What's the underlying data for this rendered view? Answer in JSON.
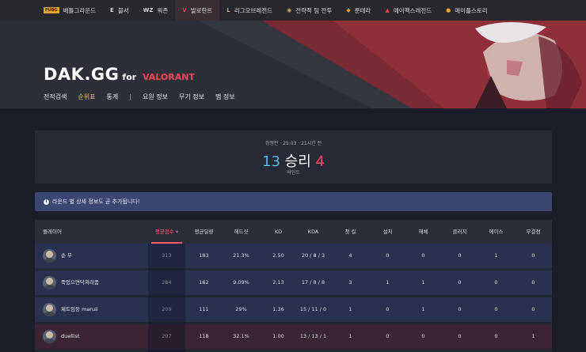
{
  "topbar": {
    "items": [
      {
        "icon": "pubg-icon",
        "glyph": "PUBG",
        "label": "배틀그라운드",
        "active": false
      },
      {
        "icon": "eternal-return-icon",
        "glyph": "E",
        "label": "블서",
        "active": false
      },
      {
        "icon": "warzone-icon",
        "glyph": "WZ",
        "label": "워존",
        "active": false
      },
      {
        "icon": "valorant-icon",
        "glyph": "V",
        "label": "발로란트",
        "active": true
      },
      {
        "icon": "lol-icon",
        "glyph": "L",
        "label": "리그오브레전드",
        "active": false
      },
      {
        "icon": "tft-icon",
        "glyph": "◉",
        "label": "전략적 팀 전투",
        "active": false
      },
      {
        "icon": "runeterra-icon",
        "glyph": "◆",
        "label": "룬테라",
        "active": false
      },
      {
        "icon": "apex-icon",
        "glyph": "▲",
        "label": "에이펙스레전드",
        "active": false
      },
      {
        "icon": "maplestory-icon",
        "glyph": "●",
        "label": "메이플스토리",
        "active": false
      }
    ]
  },
  "logo": {
    "main": "DAK.GG",
    "for": "for",
    "game": "VALORANT"
  },
  "nav": {
    "items": [
      "전적검색",
      "순위표",
      "통계"
    ],
    "separator": "|",
    "items2": [
      "요원 정보",
      "무기 정보",
      "맵 정보"
    ],
    "active": "순위표"
  },
  "match": {
    "meta": "경쟁전 · 25:03 · 21시간 전",
    "score_win": "13",
    "result": "승리",
    "score_lose": "4",
    "map": "바인드"
  },
  "notice": {
    "icon": "info-icon",
    "text": "라운드 별 상세 정보도 곧 추가됩니다!"
  },
  "table": {
    "headers": [
      "플레이어",
      "평균점수 ▾",
      "평균딜량",
      "헤드샷",
      "KD",
      "KDA",
      "첫 킬",
      "설치",
      "해체",
      "클러치",
      "에이스",
      "무결점"
    ],
    "rows": [
      {
        "team": "blue",
        "name": "순 무",
        "cells": [
          "313",
          "183",
          "21.3%",
          "2.50",
          "20 / 8 / 3",
          "4",
          "0",
          "0",
          "0",
          "1",
          "0"
        ]
      },
      {
        "team": "blue",
        "name": "죽었으면닥쳐라좀",
        "cells": [
          "284",
          "162",
          "9.09%",
          "2.13",
          "17 / 8 / 8",
          "3",
          "1",
          "1",
          "0",
          "0",
          "0"
        ]
      },
      {
        "team": "blue",
        "name": "제트임둥 maruii",
        "cells": [
          "209",
          "111",
          "29%",
          "1.36",
          "15 / 11 / 0",
          "1",
          "0",
          "1",
          "0",
          "0",
          "0"
        ]
      },
      {
        "team": "red",
        "name": "duellist",
        "cells": [
          "207",
          "118",
          "32.1%",
          "1.00",
          "13 / 13 / 1",
          "1",
          "0",
          "0",
          "0",
          "0",
          "1"
        ]
      }
    ]
  },
  "colors": {
    "accent_red": "#ff4655",
    "win_blue": "#52b6e8",
    "nav_active": "#f5c55a"
  }
}
